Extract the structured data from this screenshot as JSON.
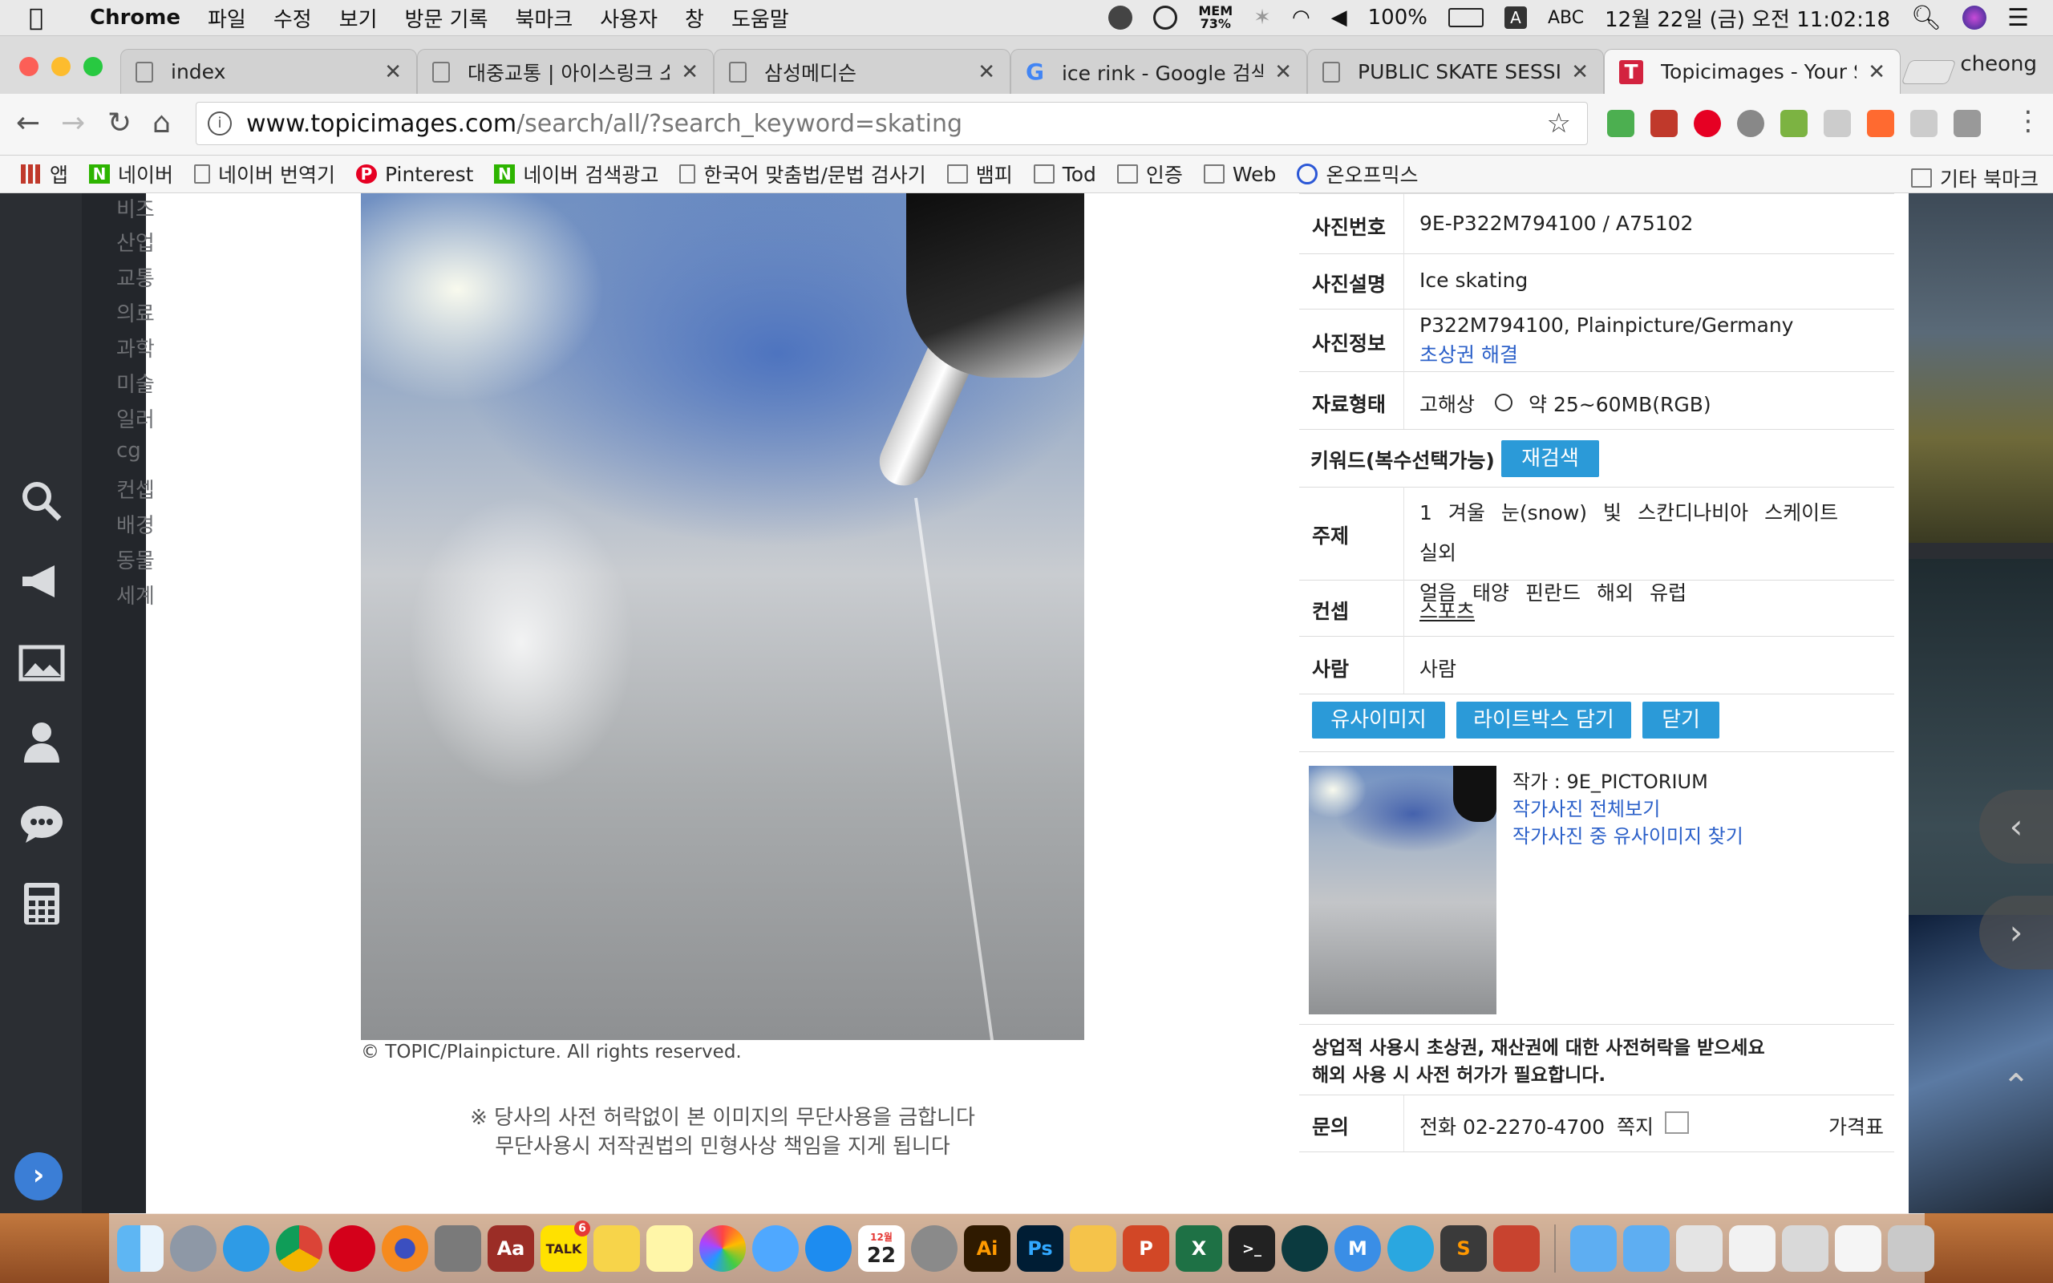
{
  "menubar": {
    "app_name": "Chrome",
    "menus": [
      "파일",
      "수정",
      "보기",
      "방문 기록",
      "북마크",
      "사용자",
      "창",
      "도움말"
    ],
    "mem_label": "MEM",
    "mem_value": "73%",
    "battery": "100%",
    "input_source": "ABC",
    "datetime": "12월 22일 (금) 오전 11:02:18"
  },
  "tabs": [
    {
      "title": "index",
      "icon": "page-icon"
    },
    {
      "title": "대중교통 | 아이스링크 소개",
      "icon": "page-icon"
    },
    {
      "title": "삼성메디슨",
      "icon": "page-icon"
    },
    {
      "title": "ice rink - Google 검색",
      "icon": "google-icon"
    },
    {
      "title": "PUBLIC SKATE SESSIO",
      "icon": "page-icon"
    },
    {
      "title": "Topicimages - Your Sa",
      "icon": "topicimages-icon"
    }
  ],
  "profile_name": "cheong",
  "omnibox": {
    "host": "www.topicimages.com",
    "path": "/search/all/?search_keyword=skating"
  },
  "bookmarks": {
    "items": [
      "앱",
      "네이버",
      "네이버 번역기",
      "Pinterest",
      "네이버 검색광고",
      "한국어 맞춤법/문법 검사기",
      "뱀피",
      "Tod",
      "인증",
      "Web",
      "온오프믹스"
    ],
    "other": "기타 북마크"
  },
  "sidebar_categories": [
    "비즈",
    "산업",
    "교통",
    "의료",
    "과학",
    "미술",
    "일러",
    "cg",
    "컨셉",
    "배경",
    "동물",
    "세계"
  ],
  "photo": {
    "credit": "© TOPIC/Plainpicture. All rights reserved.",
    "notice_line1": "※ 당사의 사전 허락없이 본 이미지의 무단사용을 금합니다",
    "notice_line2": "무단사용시 저작권법의 민형사상 책임을 지게 됩니다"
  },
  "info": {
    "photo_no_label": "사진번호",
    "photo_no": "9E-P322M794100 / A75102",
    "desc_label": "사진설명",
    "desc": "Ice skating",
    "photoinfo_label": "사진정보",
    "photoinfo": "P322M794100, Plainpicture/Germany",
    "portrait_link": "초상권 해결",
    "format_label": "자료형태",
    "format_hires": "고해상",
    "format_size": "약 25~60MB(RGB)",
    "keyword_label": "키워드(복수선택가능)",
    "research_btn": "재검색",
    "subject_label": "주제",
    "subject_keywords": [
      "1",
      "겨울",
      "눈(snow)",
      "빛",
      "스칸디나비아",
      "스케이트",
      "실외",
      "얼음",
      "태양",
      "핀란드",
      "해외",
      "유럽"
    ],
    "concept_label": "컨셉",
    "concept": "스포츠",
    "people_label": "사람",
    "people": "사람",
    "btn_similar": "유사이미지",
    "btn_lightbox": "라이트박스 담기",
    "btn_close": "닫기",
    "author": "작가 : 9E_PICTORIUM",
    "author_all": "작가사진 전체보기",
    "author_similar": "작가사진 중 유사이미지 찾기",
    "commercial_line1": "상업적 사용시 초상권, 재산권에 대한 사전허락을 받으세요",
    "commercial_line2": "해외 사용 시 사전 허가가 필요합니다.",
    "contact_label": "문의",
    "phone": "전화 02-2270-4700",
    "memo": "쪽지",
    "price": "가격표"
  },
  "dock_apps": [
    "finder-icon",
    "launchpad-icon",
    "safari-icon",
    "chrome-icon",
    "opera-icon",
    "firefox-icon",
    "calculator-icon",
    "dictionary-icon",
    "kakaotalk-icon",
    "stickies-icon",
    "notes-icon",
    "photos-icon",
    "messages-icon",
    "appstore-icon",
    "calendar-icon",
    "system-preferences-icon",
    "illustrator-icon",
    "photoshop-icon",
    "sketch-icon",
    "powerpoint-icon",
    "excel-icon",
    "terminal-icon",
    "gitkraken-icon",
    "markdown-icon",
    "sourcetree-icon",
    "sublime-icon",
    "affinity-icon",
    "folder-icon",
    "downloads-icon",
    "screenshot-icon",
    "document-icon",
    "preview-icon",
    "textfile-icon",
    "trash-icon"
  ],
  "dock_labels": {
    "kakao": "TALK",
    "kakao_badge": "6",
    "calendar_month": "12월",
    "calendar_day": "22",
    "ai": "Ai",
    "ps": "Ps",
    "dict": "Aa"
  }
}
